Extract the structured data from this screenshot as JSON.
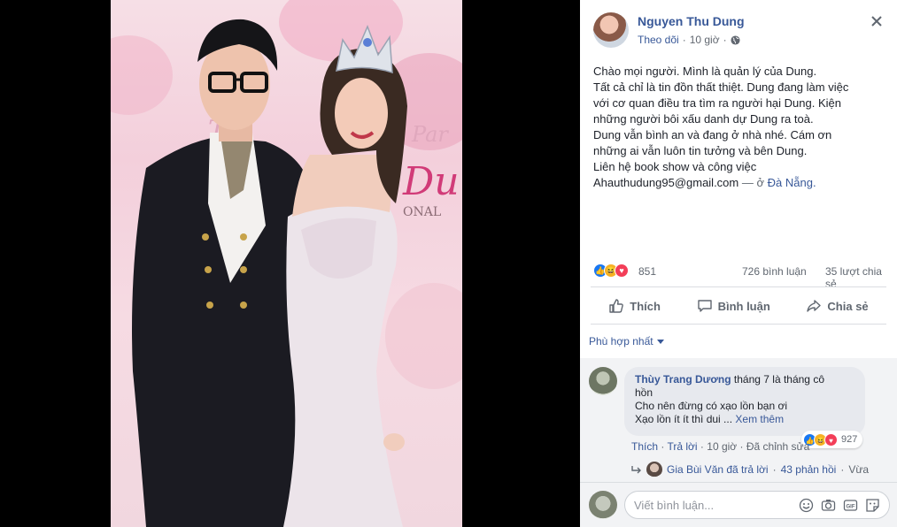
{
  "post": {
    "author": "Nguyen Thu Dung",
    "follow_label": "Theo dõi",
    "time": "10 giờ",
    "text_lines": [
      "Chào mọi người. Mình là quản lý của Dung.",
      "Tất cả chỉ là tin đồn thất thiệt. Dung đang làm việc",
      "với cơ quan điều tra tìm ra người hại Dung. Kiện",
      "những người bôi xấu danh dự Dung ra toà.",
      "Dung vẫn bình an và đang ở nhà nhé. Cám ơn",
      "những ai vẫn luôn tin tưởng và bên Dung.",
      "Liên hệ book show và công việc"
    ],
    "email": "Ahauthudung95@gmail.com",
    "location_prefix": "— ở",
    "location": "Đà Nẵng.",
    "reaction_count": "851",
    "comment_count": "726 bình luận",
    "share_count": "35 lượt chia sẻ"
  },
  "actions": {
    "like": "Thích",
    "comment": "Bình luận",
    "share": "Chia sẻ"
  },
  "sort_label": "Phù hợp nhất",
  "comment": {
    "author": "Thùy Trang Dương",
    "text_first": "tháng 7 là tháng cô",
    "text_line2": "hồn",
    "text_line3": "Cho nên đừng có xạo lồn bạn ơi",
    "text_line4": "Xạo lồn ít ít thì dui ...",
    "see_more": "Xem thêm",
    "like": "Thích",
    "reply": "Trả lời",
    "time": "10 giờ",
    "edited": "Đã chỉnh sửa",
    "reaction_count": "927",
    "dot": "·"
  },
  "reply_summary": {
    "replier": "Gia Bùi Văn đã trả lời",
    "count": "43 phản hồi",
    "time": "Vừa"
  },
  "write_placeholder": "Viết bình luận...",
  "photo_overlay": {
    "line1": "Th",
    "line2": "Par",
    "line3": "Du",
    "line4": "ONAL"
  },
  "colors": {
    "link": "#385898",
    "like_blue": "#1877f2",
    "haha_yellow": "#f7b125",
    "love_red": "#f33e58"
  }
}
